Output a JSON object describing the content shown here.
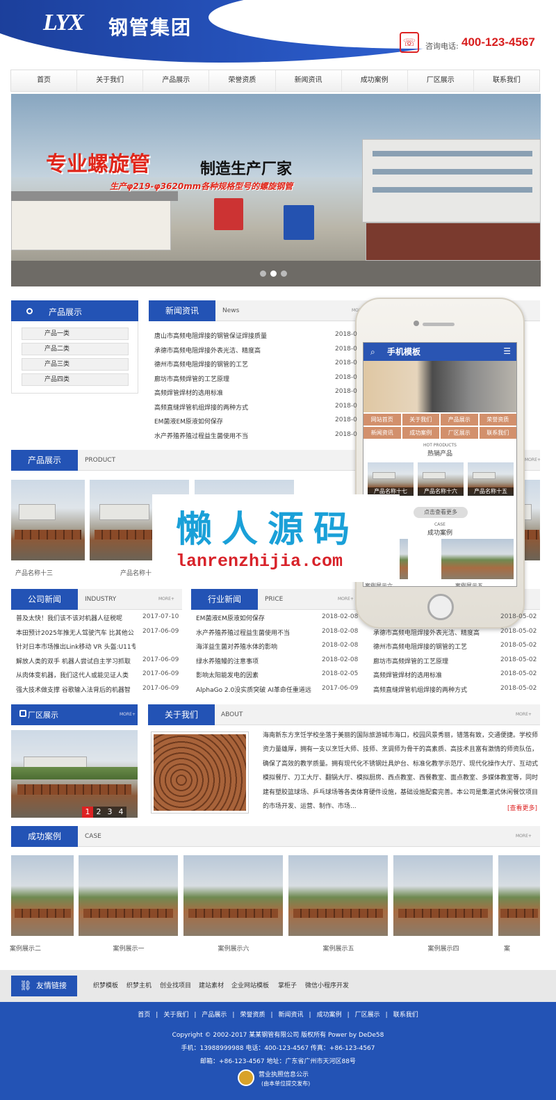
{
  "header": {
    "logo_mark": "LYX",
    "logo_text": "钢管集团",
    "tel_label": "咨询电话:",
    "tel": "400-123-4567"
  },
  "nav": [
    "首页",
    "关于我们",
    "产品展示",
    "荣誉资质",
    "新闻资讯",
    "成功案例",
    "厂区展示",
    "联系我们"
  ],
  "banner": {
    "title": "专业螺旋管",
    "subtitle": "制造生产厂家",
    "line": "生产φ219-φ3620mm各种规格型号的螺旋钢管"
  },
  "prod_side": {
    "title": "产品展示",
    "cats": [
      "产品一类",
      "产品二类",
      "产品三类",
      "产品四类"
    ]
  },
  "news": {
    "title": "新闻资讯",
    "en": "News",
    "more": "MORE+",
    "items": [
      {
        "t": "唐山市高频电阻焊接的钢管保证焊接质量",
        "d": "2018-0"
      },
      {
        "t": "承德市高频电阻焊接外表光洁、精度高",
        "d": "2018-0"
      },
      {
        "t": "德州市高频电阻焊接的钢管的工艺",
        "d": "2018-0"
      },
      {
        "t": "廊坊市高频焊管的工艺原理",
        "d": "2018-0"
      },
      {
        "t": "高频焊管焊材的选用标准",
        "d": "2018-0"
      },
      {
        "t": "高频直缝焊管机组焊接的两种方式",
        "d": "2018-0"
      },
      {
        "t": "EM菌液EM原液如何保存",
        "d": "2018-0"
      },
      {
        "t": "水产养殖养殖过程益生菌使用不当",
        "d": "2018-0"
      }
    ]
  },
  "products": {
    "title": "产品展示",
    "en": "PRODUCT",
    "more": "MORE+",
    "caps": [
      "产品名称十三",
      "产品名称十"
    ]
  },
  "company_news": {
    "title": "公司新闻",
    "en": "INDUSTRY",
    "more": "MORE+",
    "items": [
      {
        "t": "普及太快！我们该不该对机器人征税呢",
        "d": "2017-07-10"
      },
      {
        "t": "本田预计2025年推无人驾驶汽车 比其他公",
        "d": "2017-06-09"
      },
      {
        "t": "针对日本市场推出Link移动 VR 头盔:U11专属",
        "d": ""
      },
      {
        "t": "解放人类的双手 机器人尝试自主学习抓取",
        "d": "2017-06-09"
      },
      {
        "t": "从肉体变机器，我们这代人或能见证人类",
        "d": "2017-06-09"
      },
      {
        "t": "强大技术做支撑 谷歌输入法背后的机器智",
        "d": "2017-06-09"
      }
    ]
  },
  "industry_news": {
    "title": "行业新闻",
    "en": "PRICE",
    "more": "MORE+",
    "items": [
      {
        "t": "EM菌液EM原液如何保存",
        "d": "2018-02-08"
      },
      {
        "t": "水产养殖养殖过程益生菌使用不当",
        "d": "2018-02-08"
      },
      {
        "t": "海洋益生菌对养殖水体的影响",
        "d": "2018-02-08"
      },
      {
        "t": "绿水养殖鳗的注意事项",
        "d": "2018-02-08"
      },
      {
        "t": "影响太阳能发电的因素",
        "d": "2018-02-05"
      },
      {
        "t": "AlphaGo 2.0没实质突破 AI革命任重道远",
        "d": "2017-06-09"
      }
    ]
  },
  "right_news": {
    "items": [
      {
        "t": "",
        "d": "2018-05-02"
      },
      {
        "t": "承德市高频电阻焊接外表光洁、精度高",
        "d": "2018-05-02"
      },
      {
        "t": "德州市高频电阻焊接的钢管的工艺",
        "d": "2018-05-02"
      },
      {
        "t": "廊坊市高频焊管的工艺原理",
        "d": "2018-05-02"
      },
      {
        "t": "高频焊管焊材的选用标准",
        "d": "2018-05-02"
      },
      {
        "t": "高频直缝焊管机组焊接的两种方式",
        "d": "2018-05-02"
      }
    ]
  },
  "factory": {
    "title": "厂区展示",
    "more": "MORE+",
    "pages": [
      "1",
      "2",
      "3",
      "4"
    ]
  },
  "about": {
    "title": "关于我们",
    "en": "ABOUT",
    "more": "MORE+",
    "text": "海南新东方烹饪学校坐落于美丽的国际旅游城市海口，校园风景秀丽，错落有致，交通便捷。学校师资力量雄厚，拥有一支以烹饪大师、技师、烹调师为骨干的高素质、高技术且富有激情的师资队伍，确保了高效的教学质量。拥有现代化不锈钢灶具炉台、标准化教学示范厅、现代化操作大厅、互动式模拟餐厅、刀工大厅、翻锅大厅、模拟厨房、西点教室、西餐教室、面点教室、多媒体教室等，同时建有塑胶篮球场、乒乓球场等各类体育硬件设施，基础设施配套完善。本公司是集湛式休闲餐饮项目的市场开发、运营、制作、市场...",
    "readmore": "[查看更多]"
  },
  "cases": {
    "title": "成功案例",
    "en": "CASE",
    "more": "MORE+",
    "caps": [
      "案例展示二",
      "案例展示一",
      "案例展示六",
      "案例展示五",
      "案例展示四",
      "案"
    ]
  },
  "phone": {
    "title": "手机模板",
    "menu": [
      "网站首页",
      "关于我们",
      "产品展示",
      "荣誉资质",
      "新闻资讯",
      "成功案例",
      "厂区展示",
      "联系我们"
    ],
    "hot_en": "HOT PRODUCTS",
    "hot": "热销产品",
    "hot_caps": [
      "产品名称十七",
      "产品名称十六",
      "产品名称十五"
    ],
    "btn": "点击查看更多",
    "case_en": "CASE",
    "case": "成功案例",
    "case_caps": [
      "案例展示六",
      "案例展示五"
    ]
  },
  "watermark": {
    "cn": "懒人源码",
    "url": "lanrenzhijia.com"
  },
  "links": {
    "title": "友情链接",
    "items": [
      "织梦模板",
      "织梦主机",
      "创业找项目",
      "建站素材",
      "企业网站模板",
      "掌柜子",
      "微信小程序开发"
    ]
  },
  "footer": {
    "nav": [
      "首页",
      "关于我们",
      "产品展示",
      "荣誉资质",
      "新闻资讯",
      "成功案例",
      "厂区展示",
      "联系我们"
    ],
    "copy": "Copyright © 2002-2017 某某钢管有限公司 版权所有 Power by DeDe58",
    "contact": "手机：13988999988 电话：400-123-4567 传真：+86-123-4567",
    "addr": "邮箱：+86-123-4567 地址：广东省广州市天河区88号",
    "lic1": "营业执照信息公示",
    "lic2": "(由本单位提交发布)"
  }
}
